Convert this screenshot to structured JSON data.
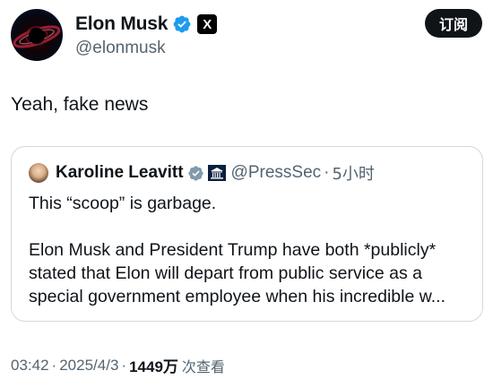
{
  "tweet": {
    "author": {
      "display_name": "Elon Musk",
      "handle": "@elonmusk",
      "verified": true,
      "affiliate_badge": "X"
    },
    "subscribe_label": "订阅",
    "text": "Yeah, fake news",
    "quoted": {
      "display_name": "Karoline Leavitt",
      "handle": "@PressSec",
      "separator": "·",
      "time": "5小时",
      "verified": true,
      "lines_para1": [
        "This “scoop” is garbage."
      ],
      "lines_para2": [
        "Elon Musk and President Trump have both *publicly*",
        "stated that Elon will depart from public service as a",
        "special government employee when his incredible w..."
      ]
    },
    "meta": {
      "time": "03:42",
      "sep1": "·",
      "date": "2025/4/3",
      "sep2": "·",
      "views": "1449万",
      "views_label": "次查看"
    }
  },
  "colors": {
    "verified_blue": "#1d9bf0",
    "text": "#0f1419",
    "secondary": "#536471",
    "border": "#cfd9de"
  }
}
